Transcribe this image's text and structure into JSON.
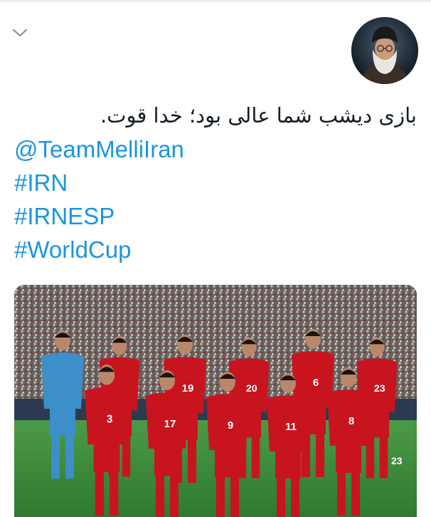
{
  "tweet": {
    "text_line": "بازی دیشب شما عالی بود؛ خدا قوت.",
    "mention": "@TeamMelliIran",
    "hashtags": [
      "#IRN",
      "#IRNESP",
      "#WorldCup"
    ]
  },
  "avatar": {
    "icon": "profile-photo"
  },
  "menu": {
    "icon": "chevron-down-icon"
  },
  "photo": {
    "subject": "team-photo",
    "back_row_numbers": [
      "19",
      "20",
      "6",
      "23"
    ],
    "front_row_numbers": [
      "3",
      "17",
      "9",
      "11",
      "8"
    ],
    "shorts_numbers": [
      "23"
    ]
  },
  "colors": {
    "link": "#1b95e0",
    "text": "#141d26",
    "kit_red": "#c8141e",
    "goalkeeper_blue": "#3d8fc9",
    "pitch_green": "#3c8a3c"
  }
}
